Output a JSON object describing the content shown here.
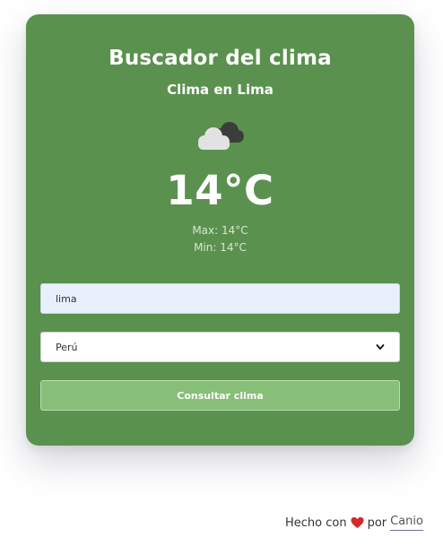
{
  "card": {
    "title": "Buscador del clima",
    "subtitle": "Clima en Lima",
    "icon": "cloudy-night-icon",
    "temperature": "14°C",
    "max": "Max: 14°C",
    "min": "Min: 14°C"
  },
  "form": {
    "city_value": "lima",
    "country_selected": "Perú",
    "submit_label": "Consultar clima"
  },
  "footer": {
    "made_with": "Hecho con",
    "by": "por",
    "author": "Canio"
  },
  "colors": {
    "card_bg": "#5a914e",
    "button_bg": "#87be78",
    "input_bg": "#e8f0fe",
    "heart": "#d22b2b"
  }
}
